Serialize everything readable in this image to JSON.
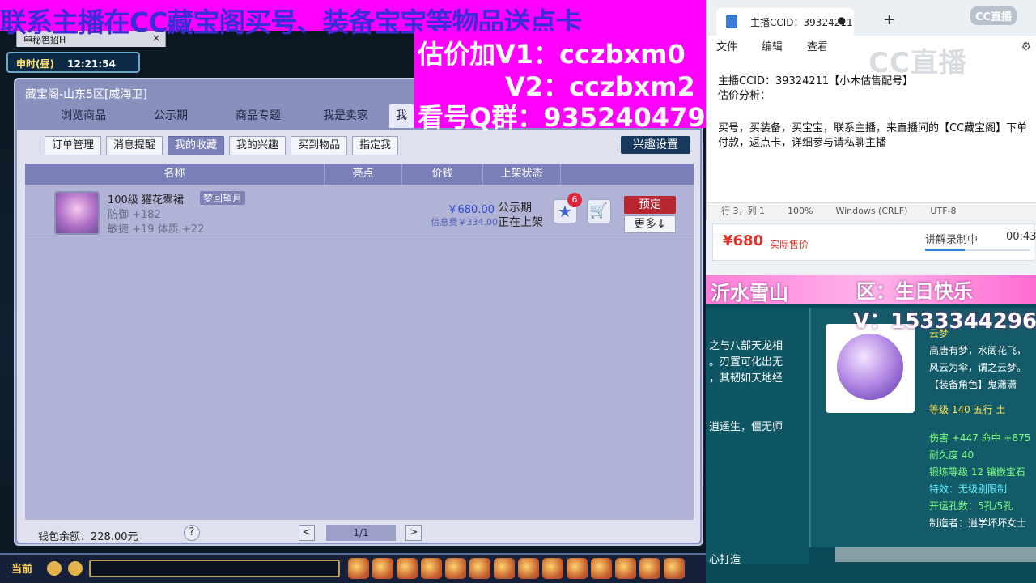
{
  "overlay": {
    "top_banner": "联系主播在CC藏宝阁买号、装备宝宝等物品送点卡",
    "line_v1": "估价加V1：cczbxm0",
    "line_v2": "V2：cczbxm2",
    "line_qq": "看号Q群：935240479"
  },
  "game": {
    "browser_tab": "申秘笆招H",
    "time_label": "申时(昼)",
    "clock": "12:21:54",
    "bottom_current": "当前"
  },
  "cbg": {
    "title": "藏宝阁-山东5区[威海卫]",
    "tabs": [
      "浏览商品",
      "公示期",
      "商品专题",
      "我是卖家",
      "我"
    ],
    "subtabs": [
      "订单管理",
      "消息提醒",
      "我的收藏",
      "我的兴趣",
      "买到物品",
      "指定我"
    ],
    "active_subtab": "我的收藏",
    "interest_button": "兴趣设置",
    "columns": [
      "名称",
      "亮点",
      "价钱",
      "上架状态"
    ],
    "item": {
      "name": "100级 獾花翠裙",
      "tag": "梦回望月",
      "attr1": "防御 +182",
      "attr2": "敏捷 +19  体质 +22",
      "price": "￥680.00",
      "fee": "信息费￥334.00",
      "state1": "公示期",
      "state2": "正在上架",
      "fav_count": "6",
      "fav_icon": "star-icon",
      "cart_icon": "cart-icon",
      "reserve_button": "预定",
      "more_button": "更多↓"
    },
    "footer": {
      "wallet": "钱包余额：228.00元",
      "help": "?",
      "prev": "<",
      "page": "1/1",
      "next": ">"
    }
  },
  "notepad": {
    "tab_title": "主播CCID：39324211",
    "tab_dot": "●",
    "plus": "+",
    "logo": "CC直播",
    "menu": [
      "文件",
      "编辑",
      "查看"
    ],
    "watermark": "CC直播",
    "line1": "主播CCID：39324211【小木估售配号】",
    "line2": "估价分析：",
    "line3": "买号，买装备，买宝宝，联系主播，来直播间的【CC藏宝阁】下单付款，返点卡，详细参与请私聊主播",
    "status": [
      "行 3，列 1",
      "100%",
      "Windows (CRLF)",
      "UTF-8"
    ]
  },
  "live": {
    "price": "¥680",
    "price_label": "实际售价",
    "recording": "讲解录制中",
    "time": "00:43",
    "progress": 0.38
  },
  "equip": {
    "pink_left": "沂水雪山",
    "pink_right": "区：生日快乐",
    "pink_phone": "V：1533344296",
    "left_lines": [
      "之与八部天龙相",
      "。刃置可化出无",
      "，其韧如天地经"
    ],
    "left_mid": "逍遥生，僵无师",
    "left_bottom": "心打造",
    "title": "云梦",
    "desc1": "高唐有梦，水阔花飞，",
    "desc2": "风云为伞，谓之云梦。",
    "role": "【装备角色】鬼潇潇",
    "level": "等级 140  五行 土",
    "damage": "伤害 +447  命中 +875",
    "durability": "耐久度 40",
    "forge": "锻炼等级 12  镶嵌宝石",
    "special": "特效：无级别限制",
    "holes": "开运孔数：5孔/5孔",
    "maker": "制造者：逍学坏坏女士"
  }
}
